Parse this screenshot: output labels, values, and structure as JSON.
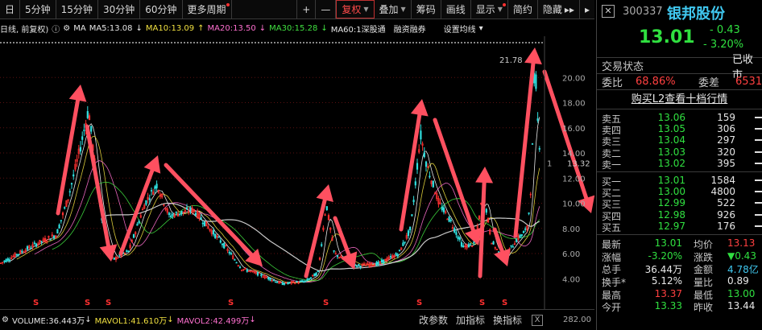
{
  "toolbar": {
    "left_items": [
      "日",
      "5分钟",
      "15分钟",
      "30分钟",
      "60分钟",
      "更多周期"
    ],
    "right_items": [
      "+",
      "—",
      "复权",
      "叠加",
      "筹码",
      "画线",
      "显示",
      "简约",
      "隐藏"
    ],
    "more_arrows": "▸▸",
    "right_arrow": "▸"
  },
  "indicator_bar": {
    "label": "日线, 前复权)",
    "ma_label": "MA",
    "ma5": "MA5:13.08",
    "ma10": "MA10:13.09",
    "ma20": "MA20:13.50",
    "ma30": "MA30:15.28",
    "ma60": "MA60:1深股通",
    "rzrq": "融资融券",
    "settings": "设置均线"
  },
  "chart_data": {
    "type": "candlestick",
    "y_ticks": [
      20.0,
      18.0,
      16.0,
      14.0,
      12.0,
      10.0,
      8.0,
      6.0,
      4.0
    ],
    "ylim": [
      2.8,
      22.0
    ],
    "max_label": "21.78",
    "current_label": "13.32",
    "tick_label_prefix": "1",
    "note_markers": "S"
  },
  "volume_bar": {
    "volume": "VOLUME:36.443万",
    "mavol1": "MAVOL1:41.610万",
    "mavol2": "MAVOL2:42.499万",
    "buttons": [
      "改参数",
      "加指标",
      "换指标"
    ],
    "close": "X",
    "axis_value": "282.00"
  },
  "quote": {
    "code": "300337",
    "name": "银邦股份",
    "price": "13.01",
    "change": "- 0.43",
    "change_pct": "- 3.20%",
    "status_label": "交易状态",
    "status_value": "已收市",
    "weibi_label": "委比",
    "weibi_value": "68.86%",
    "weicha_label": "委差",
    "weicha_value": "6531",
    "l2_button": "购买L2查看十档行情",
    "asks": [
      {
        "label": "卖五",
        "price": "13.06",
        "vol": "159"
      },
      {
        "label": "卖四",
        "price": "13.05",
        "vol": "306"
      },
      {
        "label": "卖三",
        "price": "13.04",
        "vol": "297"
      },
      {
        "label": "卖二",
        "price": "13.03",
        "vol": "320"
      },
      {
        "label": "卖一",
        "price": "13.02",
        "vol": "395"
      }
    ],
    "bids": [
      {
        "label": "买一",
        "price": "13.01",
        "vol": "1584"
      },
      {
        "label": "买二",
        "price": "13.00",
        "vol": "4800"
      },
      {
        "label": "买三",
        "price": "12.99",
        "vol": "522"
      },
      {
        "label": "买四",
        "price": "12.98",
        "vol": "926"
      },
      {
        "label": "买五",
        "price": "12.97",
        "vol": "176"
      }
    ],
    "stats": [
      {
        "l1": "最新",
        "v1": "13.01",
        "l2": "均价",
        "v2": "13.13"
      },
      {
        "l1": "涨幅",
        "v1": "-3.20%",
        "l2": "涨跌",
        "v2": "▼0.43"
      },
      {
        "l1": "总手",
        "v1": "36.44万",
        "l2": "金额",
        "v2": "4.78亿"
      },
      {
        "l1": "换手*",
        "v1": "5.12%",
        "l2": "量比",
        "v2": "0.89"
      },
      {
        "l1": "最高",
        "v1": "13.37",
        "l2": "最低",
        "v2": "13.00"
      },
      {
        "l1": "今开",
        "v1": "13.33",
        "l2": "昨收",
        "v2": "13.44"
      }
    ]
  }
}
